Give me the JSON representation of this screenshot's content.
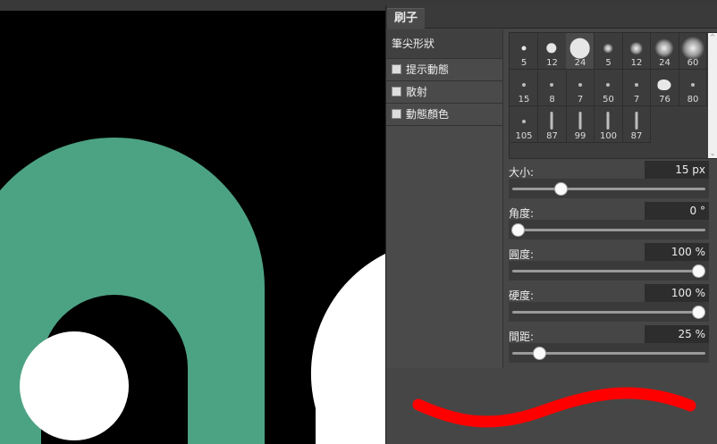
{
  "panel": {
    "tab": "刷子",
    "menu": [
      {
        "label": "筆尖形狀",
        "checkbox": false
      },
      {
        "label": "提示動態",
        "checkbox": true
      },
      {
        "label": "散射",
        "checkbox": true
      },
      {
        "label": "動態顏色",
        "checkbox": true
      }
    ]
  },
  "brushes": [
    {
      "label": "5",
      "tip": "hard-dot"
    },
    {
      "label": "12",
      "tip": "hard-dot"
    },
    {
      "label": "24",
      "tip": "hard-dot"
    },
    {
      "label": "5",
      "tip": "soft-dot"
    },
    {
      "label": "12",
      "tip": "soft-dot"
    },
    {
      "label": "24",
      "tip": "soft-dot"
    },
    {
      "label": "60",
      "tip": "soft-dot"
    },
    {
      "label": "15",
      "tip": "scatter"
    },
    {
      "label": "8",
      "tip": "scatter"
    },
    {
      "label": "7",
      "tip": "scatter"
    },
    {
      "label": "50",
      "tip": "scatter"
    },
    {
      "label": "7",
      "tip": "scatter"
    },
    {
      "label": "76",
      "tip": "blob"
    },
    {
      "label": "80",
      "tip": "scatter"
    },
    {
      "label": "105",
      "tip": "scatter"
    },
    {
      "label": "87",
      "tip": "stroke"
    },
    {
      "label": "99",
      "tip": "stroke"
    },
    {
      "label": "100",
      "tip": "stroke"
    },
    {
      "label": "87",
      "tip": "stroke"
    }
  ],
  "properties": [
    {
      "label": "大小:",
      "value": "15  px",
      "level": 0.24
    },
    {
      "label": "角度:",
      "value": "0 °",
      "level": 0.0
    },
    {
      "label": "圓度:",
      "value": "100 %",
      "level": 1.0
    },
    {
      "label": "硬度:",
      "value": "100 %",
      "level": 1.0
    },
    {
      "label": "間距:",
      "value": "25 %",
      "level": 0.12
    }
  ],
  "colors": {
    "accent_green": "#4ca383",
    "stroke_red": "#ff0000",
    "panel_bg": "#464646"
  }
}
